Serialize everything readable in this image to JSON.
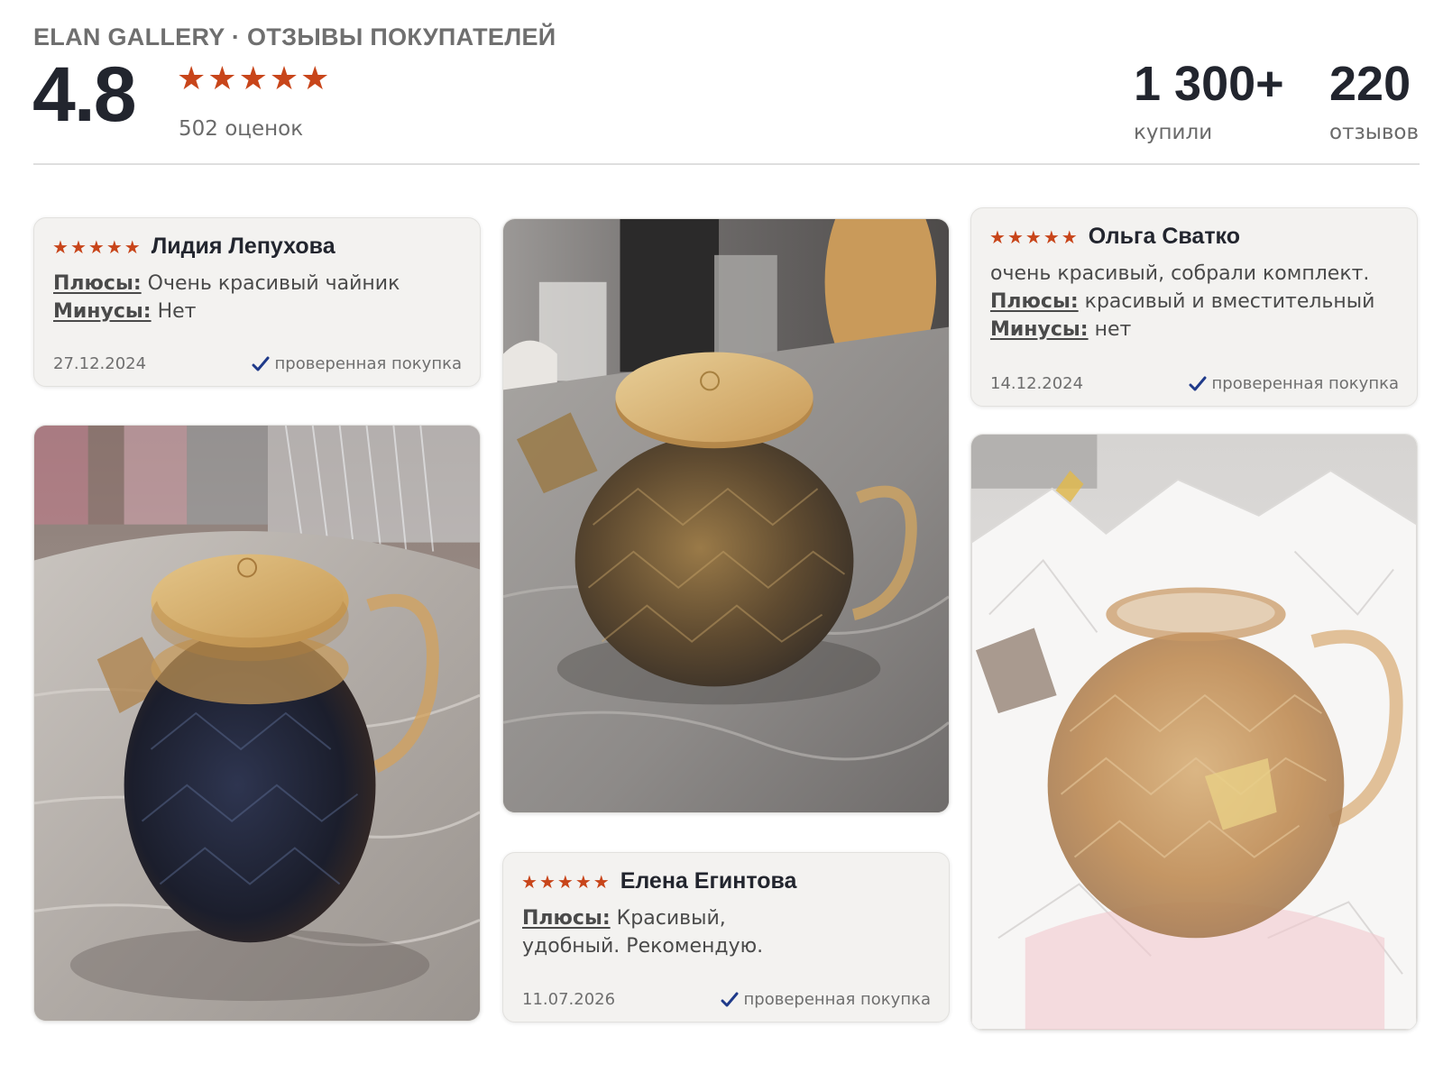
{
  "header": {
    "brand": "ELAN GALLERY · ОТЗЫВЫ ПОКУПАТЕЛЕЙ",
    "rating": "4.8",
    "rating_stars": 5,
    "ratings_count": "502 оценок",
    "bought_value": "1 300+",
    "bought_label": "купили",
    "reviews_value": "220",
    "reviews_label": "отзывов"
  },
  "colors": {
    "star": "#c8451a",
    "check": "#1f3a8a",
    "card_bg": "#f3f2f0"
  },
  "icons": {
    "star": "star-icon",
    "check": "checkmark-icon"
  },
  "reviews": [
    {
      "author": "Лидия Лепухова",
      "stars": 5,
      "text": "",
      "pros_label": "Плюсы:",
      "pros": "Очень красивый чайник",
      "cons_label": "Минусы:",
      "cons": "Нет",
      "date": "27.12.2024",
      "verified": "проверенная покупка"
    },
    {
      "author": "Ольга Сватко",
      "stars": 5,
      "text": "очень красивый, собрали комплект.",
      "pros_label": "Плюсы:",
      "pros": "красивый и вместительный",
      "cons_label": "Минусы:",
      "cons": "нет",
      "date": "14.12.2024",
      "verified": "проверенная покупка"
    },
    {
      "author": "Елена Егинтова",
      "stars": 5,
      "text": "",
      "pros_label": "Плюсы:",
      "pros": "Красивый, удобный. Рекомендую.",
      "cons_label": "",
      "cons": "",
      "date": "11.07.2026",
      "verified": "проверенная покупка"
    }
  ],
  "photos": [
    {
      "subject": "glass teapot with bamboo lid, dark tea, on marble table"
    },
    {
      "subject": "amber glass teapot with bamboo lid on grey countertop"
    },
    {
      "subject": "amber glass teapot in white tissue paper"
    }
  ]
}
